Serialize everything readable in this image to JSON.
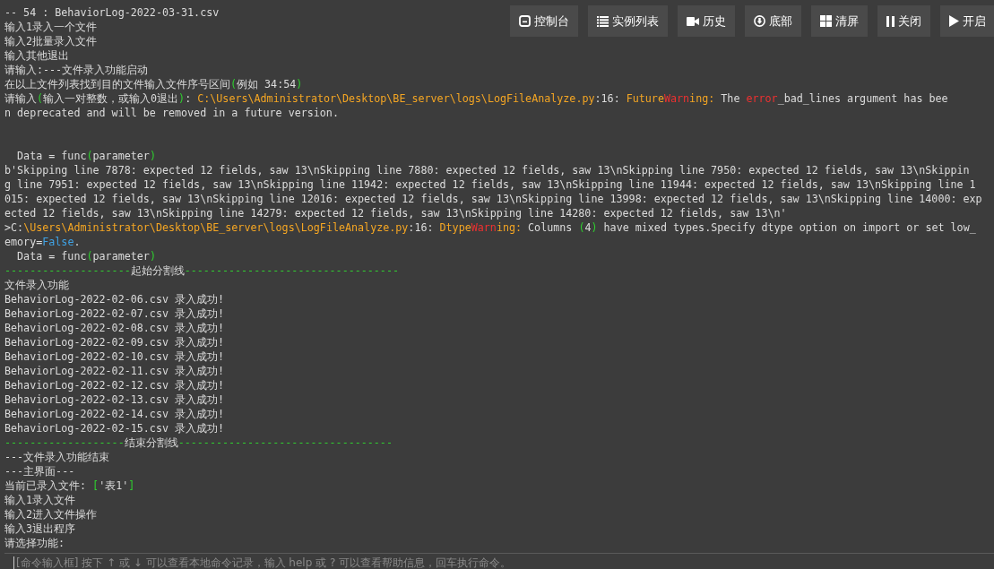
{
  "toolbar": [
    {
      "kind": "console",
      "label": "控制台"
    },
    {
      "kind": "list",
      "label": "实例列表"
    },
    {
      "kind": "camera",
      "label": "历史"
    },
    {
      "kind": "down",
      "label": "底部"
    },
    {
      "kind": "grid",
      "label": "清屏"
    },
    {
      "kind": "pause",
      "label": "关闭"
    },
    {
      "kind": "play",
      "label": "开启"
    }
  ],
  "console": [
    {
      "lines": [
        {
          "segments": [
            {
              "kind": "plain",
              "text": "-- 54 : BehaviorLog-2022-03-31.csv"
            }
          ]
        },
        {
          "segments": [
            {
              "kind": "plain",
              "text": "输入1录入一个文件"
            }
          ]
        },
        {
          "segments": [
            {
              "kind": "plain",
              "text": "输入2批量录入文件"
            }
          ]
        },
        {
          "segments": [
            {
              "kind": "plain",
              "text": "输入其他退出"
            }
          ]
        },
        {
          "segments": [
            {
              "kind": "plain",
              "text": "请输入:---文件录入功能启动"
            }
          ]
        },
        {
          "segments": [
            {
              "kind": "plain",
              "text": "在以上文件列表找到目的文件输入文件序号区间"
            },
            {
              "kind": "green",
              "text": "("
            },
            {
              "kind": "plain",
              "text": "例如 34:54"
            },
            {
              "kind": "green",
              "text": ")"
            }
          ]
        },
        {
          "segments": [
            {
              "kind": "plain",
              "text": "请输入"
            },
            {
              "kind": "green",
              "text": "("
            },
            {
              "kind": "plain",
              "text": "输入一对整数，或输入0退出"
            },
            {
              "kind": "green",
              "text": ")"
            },
            {
              "kind": "plain",
              "text": ": "
            },
            {
              "kind": "orange",
              "text": "C:\\Users\\Administrator\\Desktop\\BE_server\\logs\\LogFileAnalyze.py"
            },
            {
              "kind": "plain",
              "text": ":16: "
            },
            {
              "kind": "orange",
              "text": "Future"
            },
            {
              "kind": "red",
              "text": "Warn"
            },
            {
              "kind": "orange",
              "text": "ing:"
            },
            {
              "kind": "plain",
              "text": " The "
            },
            {
              "kind": "red",
              "text": "error"
            },
            {
              "kind": "plain",
              "text": "_bad_lines argument has bee"
            }
          ]
        },
        {
          "segments": [
            {
              "kind": "plain",
              "text": "n deprecated and will be removed in a future version."
            }
          ]
        }
      ]
    },
    {
      "lines": [
        {
          "segments": [
            {
              "kind": "plain",
              "text": "  Data = func"
            },
            {
              "kind": "green",
              "text": "("
            },
            {
              "kind": "plain",
              "text": "parameter"
            },
            {
              "kind": "green",
              "text": ")"
            }
          ]
        },
        {
          "segments": [
            {
              "kind": "plain",
              "text": "b'Skipping line 7878: expected 12 fields, saw 13\\nSkipping line 7880: expected 12 fields, saw 13\\nSkipping line 7950: expected 12 fields, saw 13\\nSkippin"
            }
          ]
        },
        {
          "segments": [
            {
              "kind": "plain",
              "text": "g line 7951: expected 12 fields, saw 13\\nSkipping line 11942: expected 12 fields, saw 13\\nSkipping line 11944: expected 12 fields, saw 13\\nSkipping line 1"
            }
          ]
        },
        {
          "segments": [
            {
              "kind": "plain",
              "text": "015: expected 12 fields, saw 13\\nSkipping line 12016: expected 12 fields, saw 13\\nSkipping line 13998: expected 12 fields, saw 13\\nSkipping line 14000: exp"
            }
          ]
        },
        {
          "segments": [
            {
              "kind": "plain",
              "text": "ected 12 fields, saw 13\\nSkipping line 14279: expected 12 fields, saw 13\\nSkipping line 14280: expected 12 fields, saw 13\\n'"
            }
          ]
        },
        {
          "segments": [
            {
              "kind": "plain",
              "text": ">C:"
            },
            {
              "kind": "orange",
              "text": "\\Users\\Administrator\\Desktop\\BE_server\\logs\\LogFileAnalyze.py"
            },
            {
              "kind": "plain",
              "text": ":16: "
            },
            {
              "kind": "orange",
              "text": "Dtype"
            },
            {
              "kind": "red",
              "text": "Warn"
            },
            {
              "kind": "orange",
              "text": "ing:"
            },
            {
              "kind": "plain",
              "text": " Columns "
            },
            {
              "kind": "green",
              "text": "("
            },
            {
              "kind": "plain",
              "text": "4"
            },
            {
              "kind": "green",
              "text": ")"
            },
            {
              "kind": "plain",
              "text": " have mixed types.Specify dtype option on import or set low_"
            }
          ]
        },
        {
          "segments": [
            {
              "kind": "plain",
              "text": "emory="
            },
            {
              "kind": "blue",
              "text": "False"
            },
            {
              "kind": "plain",
              "text": "."
            }
          ]
        },
        {
          "segments": [
            {
              "kind": "plain",
              "text": "  Data = func"
            },
            {
              "kind": "green",
              "text": "("
            },
            {
              "kind": "plain",
              "text": "parameter"
            },
            {
              "kind": "green",
              "text": ")"
            }
          ]
        },
        {
          "segments": [
            {
              "kind": "green",
              "text": "--------------------"
            },
            {
              "kind": "plain",
              "text": "起始分割线"
            },
            {
              "kind": "green",
              "text": "----------------------------------"
            }
          ]
        },
        {
          "segments": [
            {
              "kind": "plain",
              "text": "文件录入功能"
            }
          ]
        },
        {
          "segments": [
            {
              "kind": "plain",
              "text": "BehaviorLog-2022-02-06.csv 录入成功!"
            }
          ]
        },
        {
          "segments": [
            {
              "kind": "plain",
              "text": "BehaviorLog-2022-02-07.csv 录入成功!"
            }
          ]
        },
        {
          "segments": [
            {
              "kind": "plain",
              "text": "BehaviorLog-2022-02-08.csv 录入成功!"
            }
          ]
        },
        {
          "segments": [
            {
              "kind": "plain",
              "text": "BehaviorLog-2022-02-09.csv 录入成功!"
            }
          ]
        },
        {
          "segments": [
            {
              "kind": "plain",
              "text": "BehaviorLog-2022-02-10.csv 录入成功!"
            }
          ]
        },
        {
          "segments": [
            {
              "kind": "plain",
              "text": "BehaviorLog-2022-02-11.csv 录入成功!"
            }
          ]
        },
        {
          "segments": [
            {
              "kind": "plain",
              "text": "BehaviorLog-2022-02-12.csv 录入成功!"
            }
          ]
        },
        {
          "segments": [
            {
              "kind": "plain",
              "text": "BehaviorLog-2022-02-13.csv 录入成功!"
            }
          ]
        },
        {
          "segments": [
            {
              "kind": "plain",
              "text": "BehaviorLog-2022-02-14.csv 录入成功!"
            }
          ]
        },
        {
          "segments": [
            {
              "kind": "plain",
              "text": "BehaviorLog-2022-02-15.csv 录入成功!"
            }
          ]
        },
        {
          "segments": [
            {
              "kind": "green",
              "text": "-------------------"
            },
            {
              "kind": "plain",
              "text": "结束分割线"
            },
            {
              "kind": "green",
              "text": "----------------------------------"
            }
          ]
        },
        {
          "segments": [
            {
              "kind": "plain",
              "text": "---文件录入功能结束"
            }
          ]
        },
        {
          "segments": [
            {
              "kind": "plain",
              "text": "---主界面---"
            }
          ]
        },
        {
          "segments": [
            {
              "kind": "plain",
              "text": "当前已录入文件: "
            },
            {
              "kind": "green",
              "text": "["
            },
            {
              "kind": "plain",
              "text": "'表1'"
            },
            {
              "kind": "green",
              "text": "]"
            }
          ]
        },
        {
          "segments": [
            {
              "kind": "plain",
              "text": "输入1录入文件"
            }
          ]
        },
        {
          "segments": [
            {
              "kind": "plain",
              "text": "输入2进入文件操作"
            }
          ]
        },
        {
          "segments": [
            {
              "kind": "plain",
              "text": "输入3退出程序"
            }
          ]
        },
        {
          "segments": [
            {
              "kind": "plain",
              "text": "请选择功能:"
            }
          ]
        }
      ]
    }
  ],
  "command_input": {
    "placeholder": "[命令输入框] 按下 ↑ 或 ↓ 可以查看本地命令记录，输入 help 或 ? 可以查看帮助信息，回车执行命令。"
  }
}
